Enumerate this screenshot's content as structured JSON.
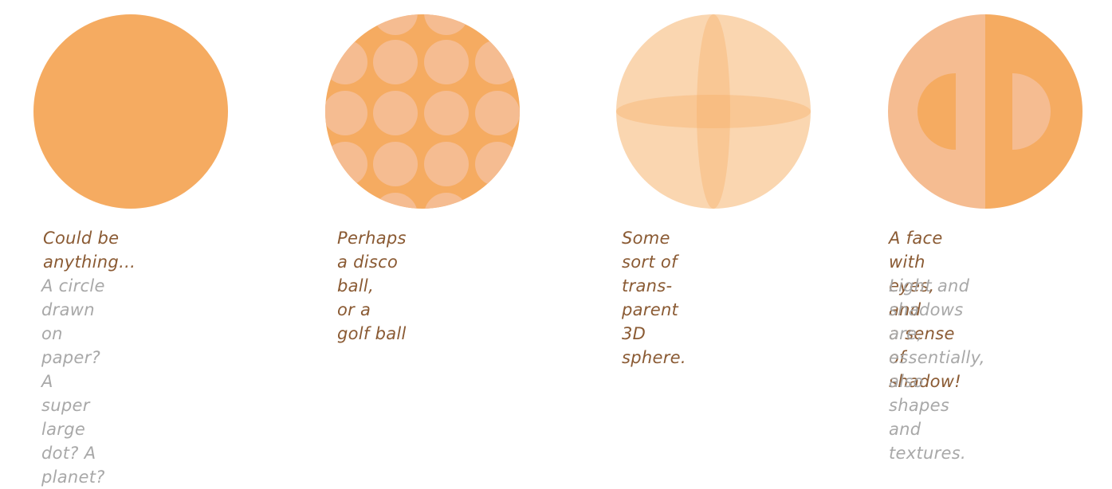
{
  "colors": {
    "orange": "#f5ab61",
    "light_peach": "#f5bc91",
    "pale_peach": "#fad6b0",
    "mid_peach": "#f7c18a",
    "caption": "#8a5a33",
    "note": "#a8a8a8"
  },
  "panels": [
    {
      "figure": "plain-circle",
      "caption": "Could be anything…",
      "note": "A circle drawn on\npaper? A super large\ndot? A planet?"
    },
    {
      "figure": "dotted-circle",
      "caption": "Perhaps a disco ball,\nor a golf ball",
      "note": ""
    },
    {
      "figure": "transparent-sphere",
      "caption": "Some sort of trans-\nparent 3D sphere.",
      "note": ""
    },
    {
      "figure": "face-circle",
      "caption": "A face with eyes, and\na sense of shadow!",
      "note": "Light and shadows\nare, essentially, also\nshapes and textures."
    }
  ]
}
